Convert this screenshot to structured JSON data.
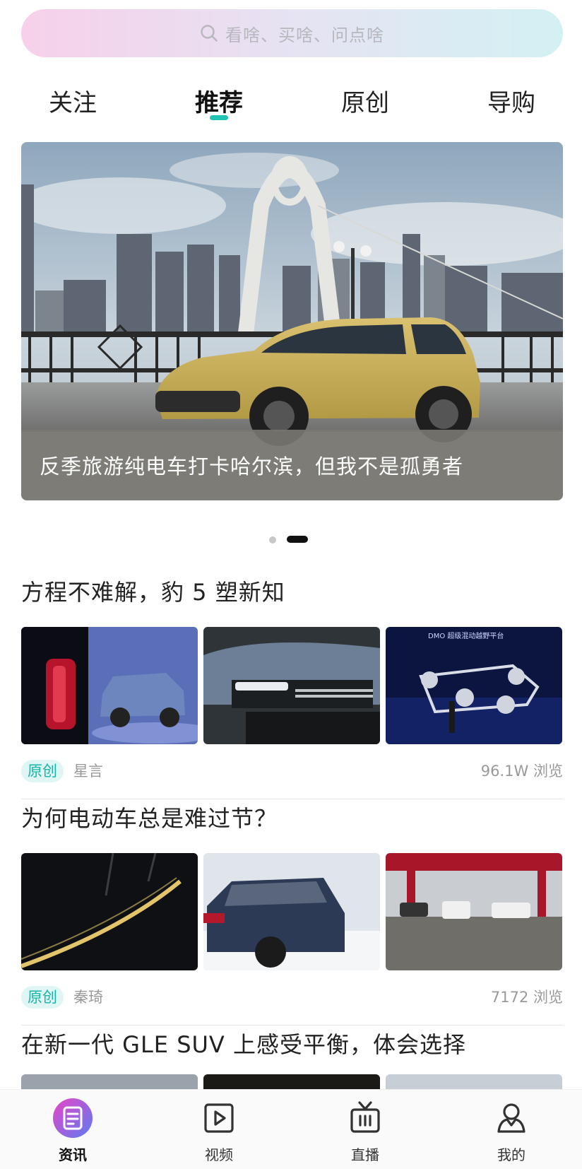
{
  "search": {
    "placeholder": "看啥、买啥、问点啥",
    "icon": "search-icon"
  },
  "tabs": [
    {
      "label": "关注",
      "active": false
    },
    {
      "label": "推荐",
      "active": true
    },
    {
      "label": "原创",
      "active": false
    },
    {
      "label": "导购",
      "active": false
    }
  ],
  "banner": {
    "caption": "反季旅游纯电车打卡哈尔滨，但我不是孤勇者",
    "page_count": 2,
    "active_page": 2
  },
  "articles": [
    {
      "title": "方程不难解，豹 5 塑新知",
      "tag": "原创",
      "author": "星言",
      "views": "96.1W 浏览",
      "thumb3_text": "DMO  超级混动越野平台"
    },
    {
      "title": "为何电动车总是难过节？",
      "tag": "原创",
      "author": "秦琦",
      "views": "7172 浏览"
    },
    {
      "title": "在新一代 GLE SUV 上感受平衡，体会选择"
    }
  ],
  "bottom_nav": [
    {
      "label": "资讯",
      "icon": "news-icon",
      "active": true
    },
    {
      "label": "视频",
      "icon": "video-icon",
      "active": false
    },
    {
      "label": "直播",
      "icon": "live-tv-icon",
      "active": false
    },
    {
      "label": "我的",
      "icon": "profile-icon",
      "active": false
    }
  ],
  "colors": {
    "accent": "#20c3b4",
    "tag_bg": "#dff6f5",
    "tag_text": "#17b5a7",
    "news_icon_gradient": [
      "#e845c8",
      "#5b7cf0"
    ]
  }
}
